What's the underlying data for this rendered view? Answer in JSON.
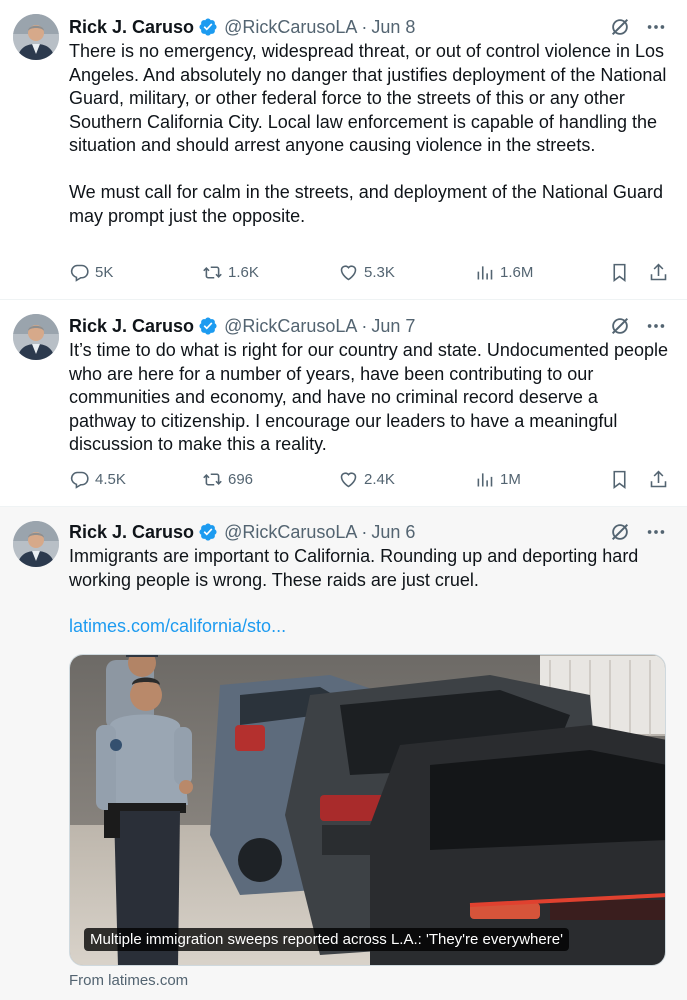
{
  "tweets": [
    {
      "name": "Rick J. Caruso",
      "handle": "@RickCarusoLA",
      "separator": "·",
      "date": "Jun 8",
      "text": "There is no emergency, widespread threat, or out of control violence in Los Angeles. And absolutely no danger that justifies deployment of the National Guard, military, or other federal force to the streets of this or any other Southern California City. Local law enforcement is capable of handling the situation and should arrest anyone causing violence in the streets.\n\nWe must call for calm in the streets, and deployment of the National Guard may prompt just the opposite.",
      "replies": "5K",
      "reposts": "1.6K",
      "likes": "5.3K",
      "views": "1.6M"
    },
    {
      "name": "Rick J. Caruso",
      "handle": "@RickCarusoLA",
      "separator": "·",
      "date": "Jun 7",
      "text": "It’s time to do what is right for our country and state. Undocumented people who are here for a number of years, have been contributing to our communities and economy, and have no criminal record deserve a pathway to citizenship. I encourage our leaders to have a meaningful discussion to make this a reality.",
      "replies": "4.5K",
      "reposts": "696",
      "likes": "2.4K",
      "views": "1M"
    },
    {
      "name": "Rick J. Caruso",
      "handle": "@RickCarusoLA",
      "separator": "·",
      "date": "Jun 6",
      "text": "Immigrants are important to California. Rounding up and deporting hard working people is wrong. These raids are just cruel.",
      "link": "latimes.com/california/sto...",
      "card_caption": "Multiple immigration sweeps reported across L.A.: 'They're everywhere'",
      "card_source": "From latimes.com"
    }
  ],
  "colors": {
    "text": "#0f1419",
    "secondary": "#536471",
    "link": "#1d9bf0",
    "verified": "#1d9bf0"
  },
  "icons": [
    "verified-badge-icon",
    "grok-icon",
    "more-icon",
    "reply-icon",
    "repost-icon",
    "like-icon",
    "views-icon",
    "bookmark-icon",
    "share-icon"
  ]
}
